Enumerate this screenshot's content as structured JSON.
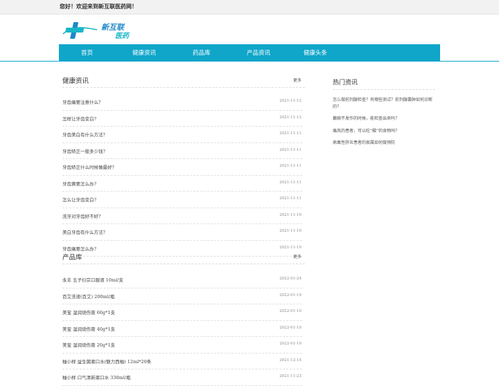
{
  "topbar": {
    "welcome": "您好！欢迎来到新互联医药网！"
  },
  "logo": {
    "text_line1": "新互联",
    "text_line2": "医药"
  },
  "nav": {
    "items": [
      "首页",
      "健康资讯",
      "药品库",
      "产品资讯",
      "健康头条"
    ]
  },
  "health_news": {
    "title": "健康资讯",
    "more": "更多",
    "items": [
      {
        "title": "牙齿痛要注意什么？",
        "date": "2021-11-12"
      },
      {
        "title": "怎样让牙齿变白?",
        "date": "2021-11-12"
      },
      {
        "title": "牙齿美白有什么方法？",
        "date": "2021-11-11"
      },
      {
        "title": "牙齿矫正一般多少钱?",
        "date": "2021-11-11"
      },
      {
        "title": "牙齿矫正什么时候做最好？",
        "date": "2021-11-11"
      },
      {
        "title": "牙齿黄要怎么办?",
        "date": "2021-11-11"
      },
      {
        "title": "怎么让牙齿变白?",
        "date": "2021-11-11"
      },
      {
        "title": "洗牙对牙齿好不好?",
        "date": "2021-11-10"
      },
      {
        "title": "美白牙齿有什么方法？",
        "date": "2021-11-10"
      },
      {
        "title": "牙齿痛要怎么办?",
        "date": "2021-11-10"
      }
    ]
  },
  "products": {
    "title": "产品库",
    "more": "更多",
    "items": [
      {
        "title": "永丰 五子衍宗口服液 10ml/支",
        "date": "2022-01-24"
      },
      {
        "title": "百艾洗液(百艾) 200ml/瓶",
        "date": "2022-01-19"
      },
      {
        "title": "美宝 湿润烧伤膏 60g*1支",
        "date": "2022-01-10"
      },
      {
        "title": "美宝 湿润烧伤膏 40g*1支",
        "date": "2022-01-10"
      },
      {
        "title": "美宝 湿润烧伤膏 20g*1支",
        "date": "2022-01-10"
      },
      {
        "title": "柚小样 益生菌漱口水(魅力西柚) 12ml*20条",
        "date": "2021-12-14"
      },
      {
        "title": "柚小样 口气清新漱口水 330ml/瓶",
        "date": "2021-11-23"
      }
    ]
  },
  "hot_news": {
    "title": "热门资讯",
    "items": [
      "怎么做前列腺检查？有哪些测试？前列腺囊肿如何诊断的？",
      "癫痫不发作的时候，能检查出来吗？",
      "痛风的患者，可以吃“酸”的食物吗？",
      "病毒性肝炎患者的家属如何做预防"
    ]
  },
  "colors": {
    "accent": "#0fa6c9",
    "logo_blue": "#1e88c8",
    "logo_teal": "#19b6c8"
  }
}
